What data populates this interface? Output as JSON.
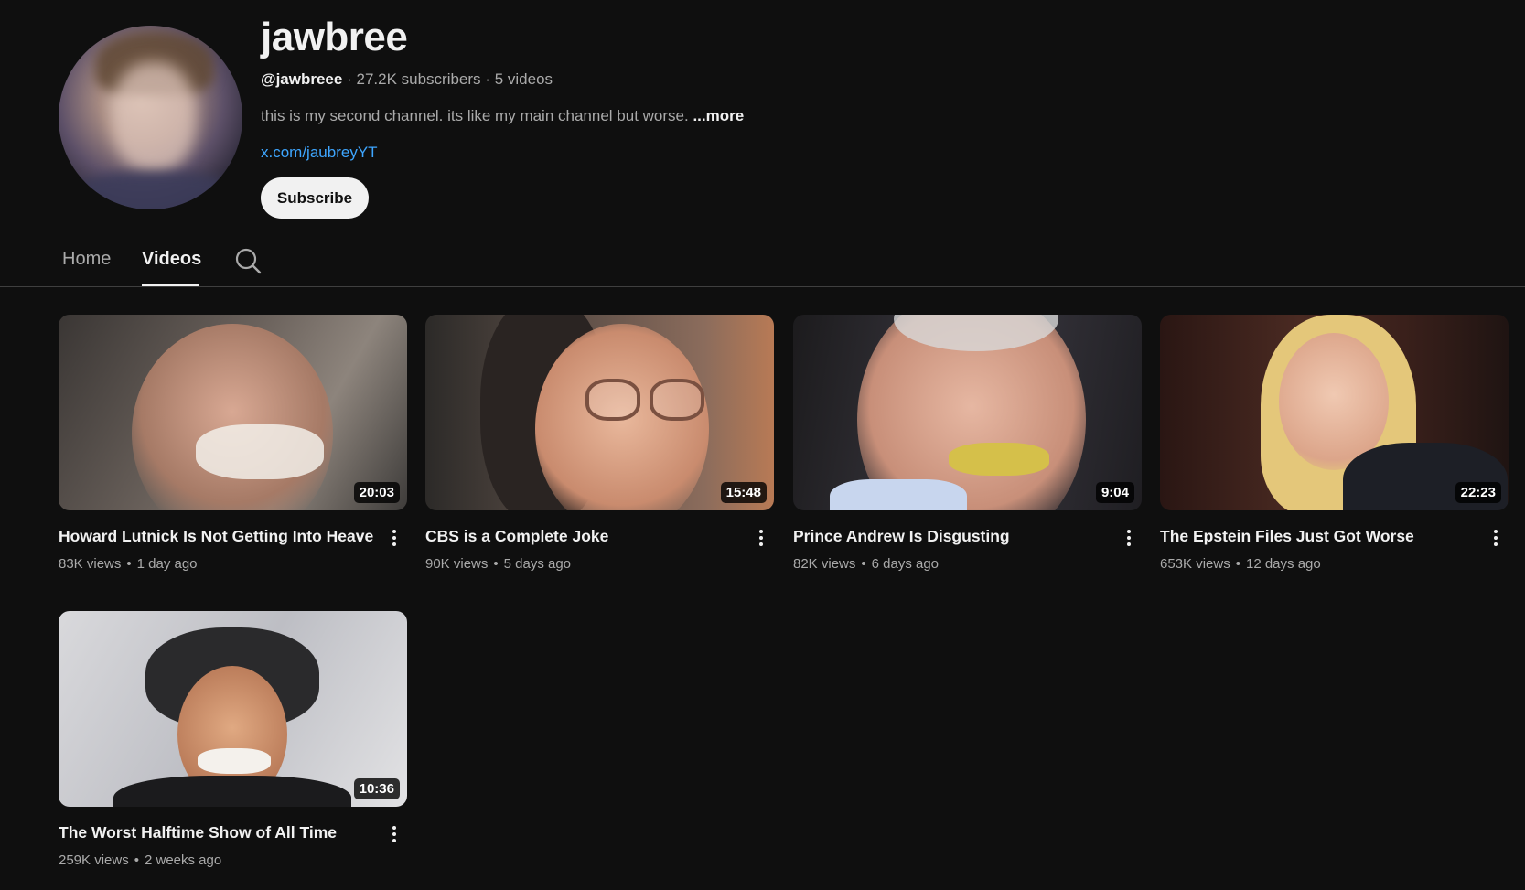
{
  "channel": {
    "name": "jawbree",
    "handle": "@jawbreee",
    "sep1": "·",
    "subscribers": "27.2K subscribers",
    "sep2": "·",
    "video_count": "5 videos",
    "description": "this is my second channel. its like my main channel but worse.",
    "more_label": "...more",
    "link": "x.com/jaubreyYT",
    "subscribe_label": "Subscribe"
  },
  "tabs": [
    {
      "label": "Home",
      "active": false
    },
    {
      "label": "Videos",
      "active": true
    }
  ],
  "icons": {
    "tab_search": "search-icon",
    "video_menu": "more-vert-icon"
  },
  "colors": {
    "background": "#0f0f0f",
    "text_primary": "#f1f1f1",
    "text_secondary": "#aaaaaa",
    "link": "#3ea6ff"
  },
  "videos": [
    {
      "title": "Howard Lutnick Is Not Getting Into Heaven",
      "views": "83K views",
      "sep": "•",
      "age": "1 day ago",
      "duration": "20:03"
    },
    {
      "title": "CBS is a Complete Joke",
      "views": "90K views",
      "sep": "•",
      "age": "5 days ago",
      "duration": "15:48"
    },
    {
      "title": "Prince Andrew Is Disgusting",
      "views": "82K views",
      "sep": "•",
      "age": "6 days ago",
      "duration": "9:04"
    },
    {
      "title": "The Epstein Files Just Got Worse",
      "views": "653K views",
      "sep": "•",
      "age": "12 days ago",
      "duration": "22:23"
    },
    {
      "title": "The Worst Halftime Show of All Time",
      "views": "259K views",
      "sep": "•",
      "age": "2 weeks ago",
      "duration": "10:36"
    }
  ]
}
